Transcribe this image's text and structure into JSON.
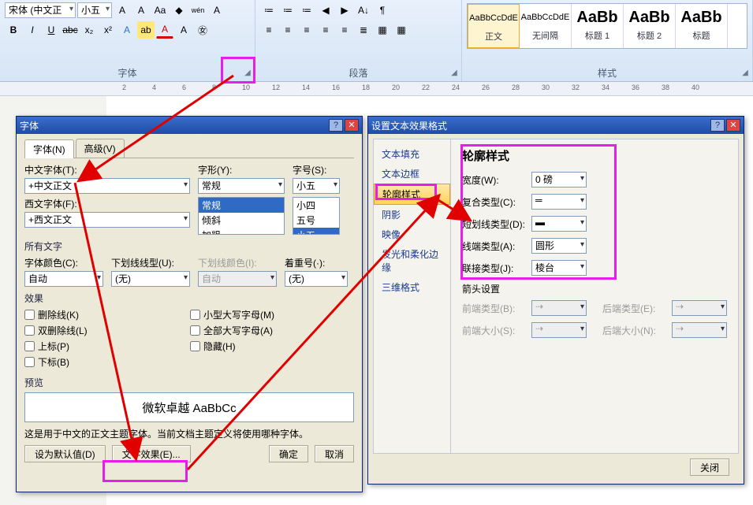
{
  "ribbon": {
    "font_group": {
      "label": "字体",
      "font_family": "宋体 (中文正",
      "font_size": "小五",
      "grow": "A",
      "shrink": "A",
      "clear": "Aa",
      "phonetic": "wén",
      "charborder": "A",
      "bold": "B",
      "italic": "I",
      "underline": "U",
      "strike": "abc",
      "sub": "x₂",
      "sup": "x²",
      "fx": "A",
      "highlight": "ab",
      "color": "A"
    },
    "para_group": {
      "label": "段落",
      "bullets": "≔",
      "numbers": "≔",
      "multilevel": "≔",
      "dec": "◀",
      "inc": "▶",
      "az": "A↓",
      "showmarks": "¶",
      "al": "≡",
      "ac": "≡",
      "ar": "≡",
      "aj": "≡",
      "ad": "≡",
      "lh": "≣",
      "shade": "▦",
      "border": "▦"
    },
    "style_group": {
      "label": "样式",
      "items": [
        {
          "preview": "AaBbCcDdE",
          "name": "正文"
        },
        {
          "preview": "AaBbCcDdE",
          "name": "无间隔"
        },
        {
          "preview": "AaBb",
          "name": "标题 1"
        },
        {
          "preview": "AaBb",
          "name": "标题 2"
        },
        {
          "preview": "AaBb",
          "name": "标题"
        }
      ]
    }
  },
  "ruler_marks": [
    "2",
    "4",
    "6",
    "8",
    "10",
    "12",
    "14",
    "16",
    "18",
    "20",
    "22",
    "24",
    "26",
    "28",
    "30",
    "32",
    "34",
    "36",
    "38",
    "40"
  ],
  "font_dlg": {
    "title": "字体",
    "tabs": {
      "font": "字体(N)",
      "adv": "高级(V)"
    },
    "cn_font_label": "中文字体(T):",
    "cn_font": "+中文正文",
    "west_font_label": "西文字体(F):",
    "west_font": "+西文正文",
    "style_label": "字形(Y):",
    "style": "常规",
    "style_list": [
      "常规",
      "倾斜",
      "加粗"
    ],
    "size_label": "字号(S):",
    "size": "小五",
    "size_list": [
      "小四",
      "五号",
      "小五"
    ],
    "all_text": "所有文字",
    "color_label": "字体颜色(C):",
    "color": "自动",
    "ul_style_label": "下划线线型(U):",
    "ul_style": "(无)",
    "ul_color_label": "下划线颜色(I):",
    "ul_color": "自动",
    "emph_label": "着重号(·):",
    "emph": "(无)",
    "effects": "效果",
    "chk_strike": "删除线(K)",
    "chk_dstrike": "双删除线(L)",
    "chk_sup": "上标(P)",
    "chk_sub": "下标(B)",
    "chk_smallcap": "小型大写字母(M)",
    "chk_allcap": "全部大写字母(A)",
    "chk_hidden": "隐藏(H)",
    "preview_label": "预览",
    "preview_text": "微软卓越 AaBbCc",
    "hint": "这是用于中文的正文主题字体。当前文档主题定义将使用哪种字体。",
    "btn_default": "设为默认值(D)",
    "btn_fx": "文字效果(E)...",
    "btn_ok": "确定",
    "btn_cancel": "取消"
  },
  "fx_dlg": {
    "title": "设置文本效果格式",
    "side": [
      "文本填充",
      "文本边框",
      "轮廓样式",
      "阴影",
      "映像",
      "发光和柔化边缘",
      "三维格式"
    ],
    "heading": "轮廓样式",
    "width_label": "宽度(W):",
    "width": "0 磅",
    "compound_label": "复合类型(C):",
    "dash_label": "短划线类型(D):",
    "cap_label": "线端类型(A):",
    "cap": "圆形",
    "join_label": "联接类型(J):",
    "join": "棱台",
    "arrow_hdr": "箭头设置",
    "arrow_begin_type": "前端类型(B):",
    "arrow_end_type": "后端类型(E):",
    "arrow_begin_size": "前端大小(S):",
    "arrow_end_size": "后端大小(N):",
    "close": "关闭"
  }
}
